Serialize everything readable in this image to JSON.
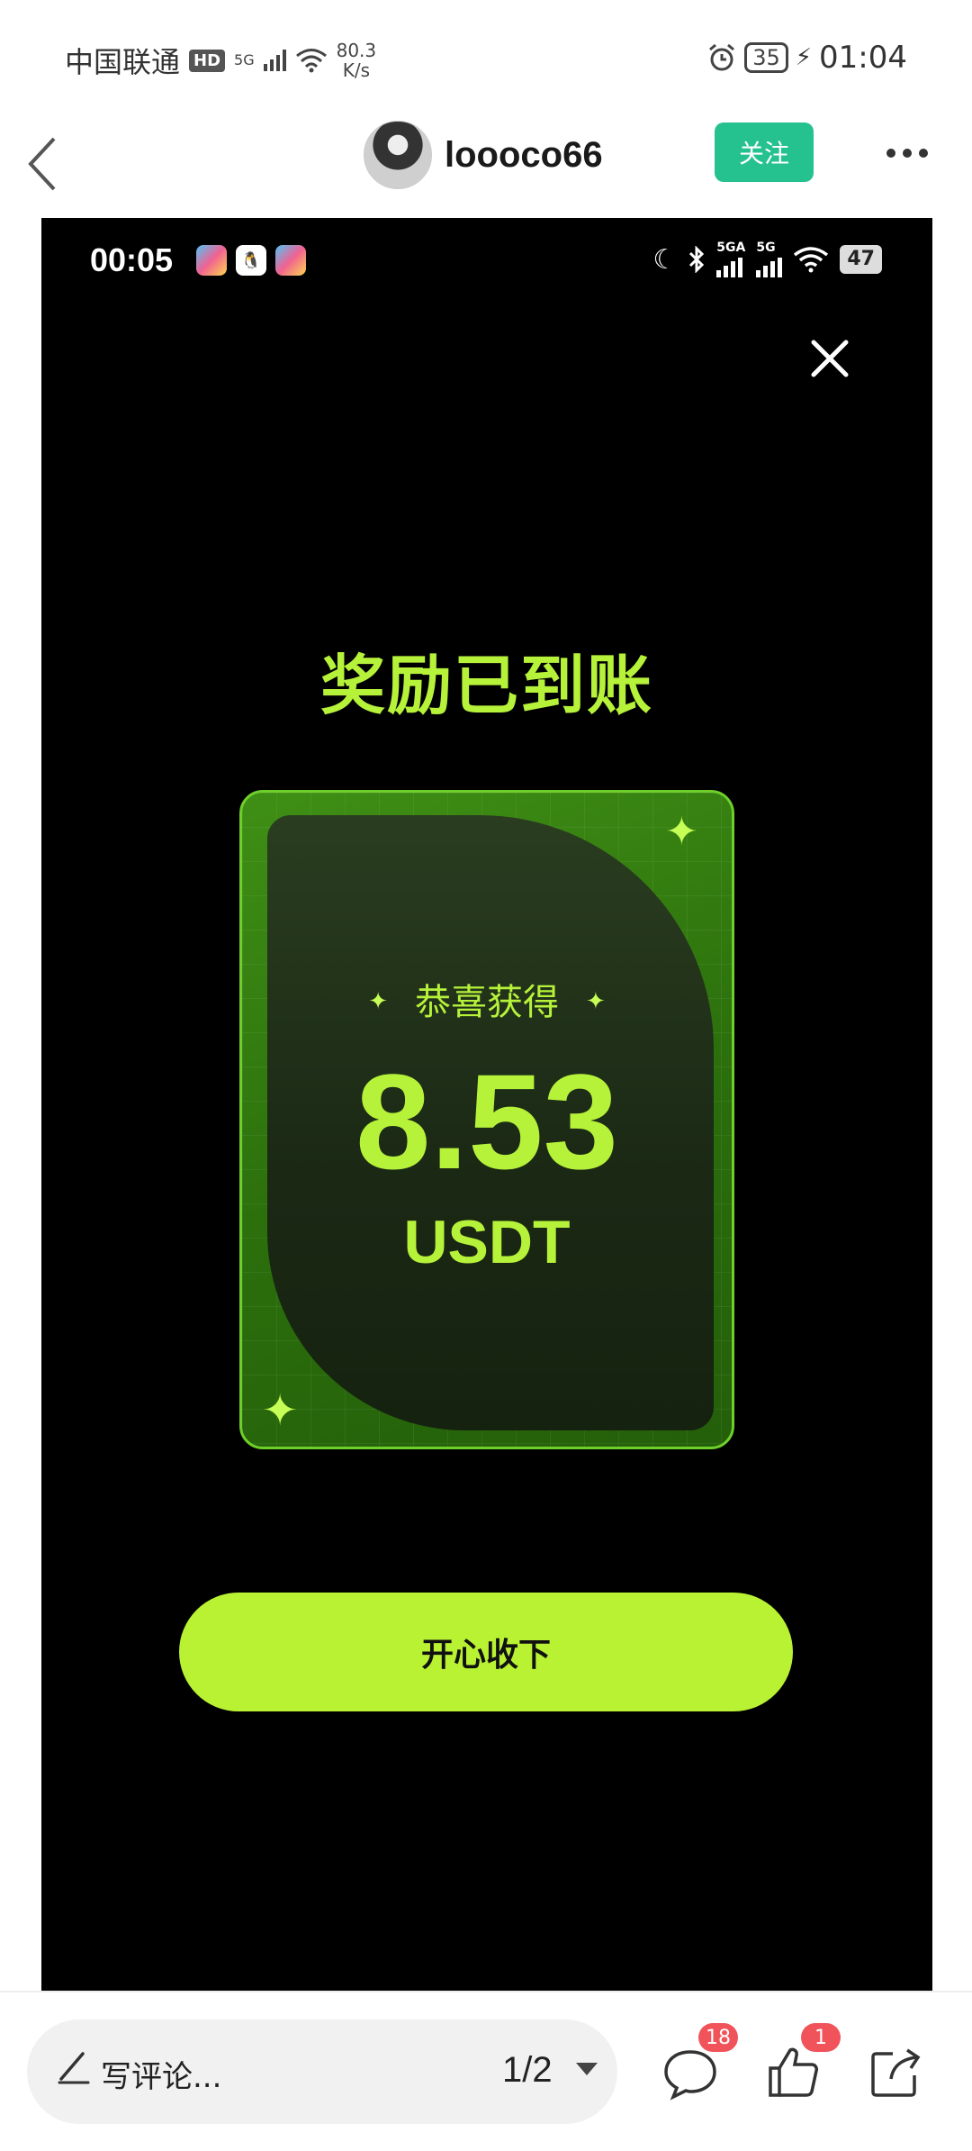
{
  "status_bar": {
    "carrier": "中国联通",
    "hd": "HD",
    "net": "5G",
    "speed_value": "80.3",
    "speed_unit": "K/s",
    "battery": "35",
    "time": "01:04"
  },
  "header": {
    "username": "loooco66",
    "follow_label": "关注"
  },
  "screenshot": {
    "status": {
      "time": "00:05",
      "net1": "5GA",
      "net2": "5G",
      "battery": "47"
    },
    "title": "奖励已到账",
    "card": {
      "congrats": "恭喜获得",
      "amount": "8.53",
      "unit": "USDT"
    },
    "accept_label": "开心收下"
  },
  "bottom": {
    "comment_placeholder": "写评论...",
    "page_indicator": "1/2",
    "comment_count": "18",
    "like_count": "1"
  },
  "colors": {
    "accent_green": "#b6f23a",
    "follow_button": "#25c18f",
    "badge_red": "#f0535a"
  },
  "icons": [
    "back-arrow-icon",
    "more-icon",
    "close-icon",
    "sparkle-icon",
    "pen-icon",
    "comment-icon",
    "like-icon",
    "share-icon",
    "alarm-icon",
    "wifi-icon",
    "moon-icon",
    "bluetooth-icon"
  ]
}
